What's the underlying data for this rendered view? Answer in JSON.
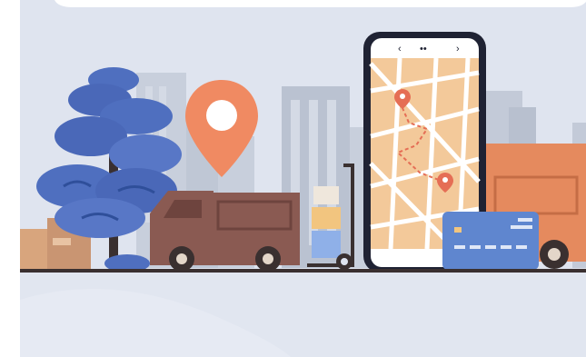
{
  "illustration": {
    "subject": "delivery-logistics",
    "phone_status_glyphs": [
      "‹",
      "••",
      "›"
    ],
    "colors": {
      "background": "#dfe4ef",
      "buildings": "#c3cad8",
      "buildings_dark": "#b4bccc",
      "tree": "#4f6fbf",
      "tree_dark": "#2f4f9a",
      "van": "#8a5a52",
      "van_dark": "#6e443e",
      "truck": "#e58a5e",
      "pin": "#f08a62",
      "phone_body": "#1f2233",
      "map": "#f3c99a",
      "route": "#e56e55",
      "card": "#5f86cf",
      "road": "#3a3030",
      "boxes": "#d8a57d"
    }
  }
}
